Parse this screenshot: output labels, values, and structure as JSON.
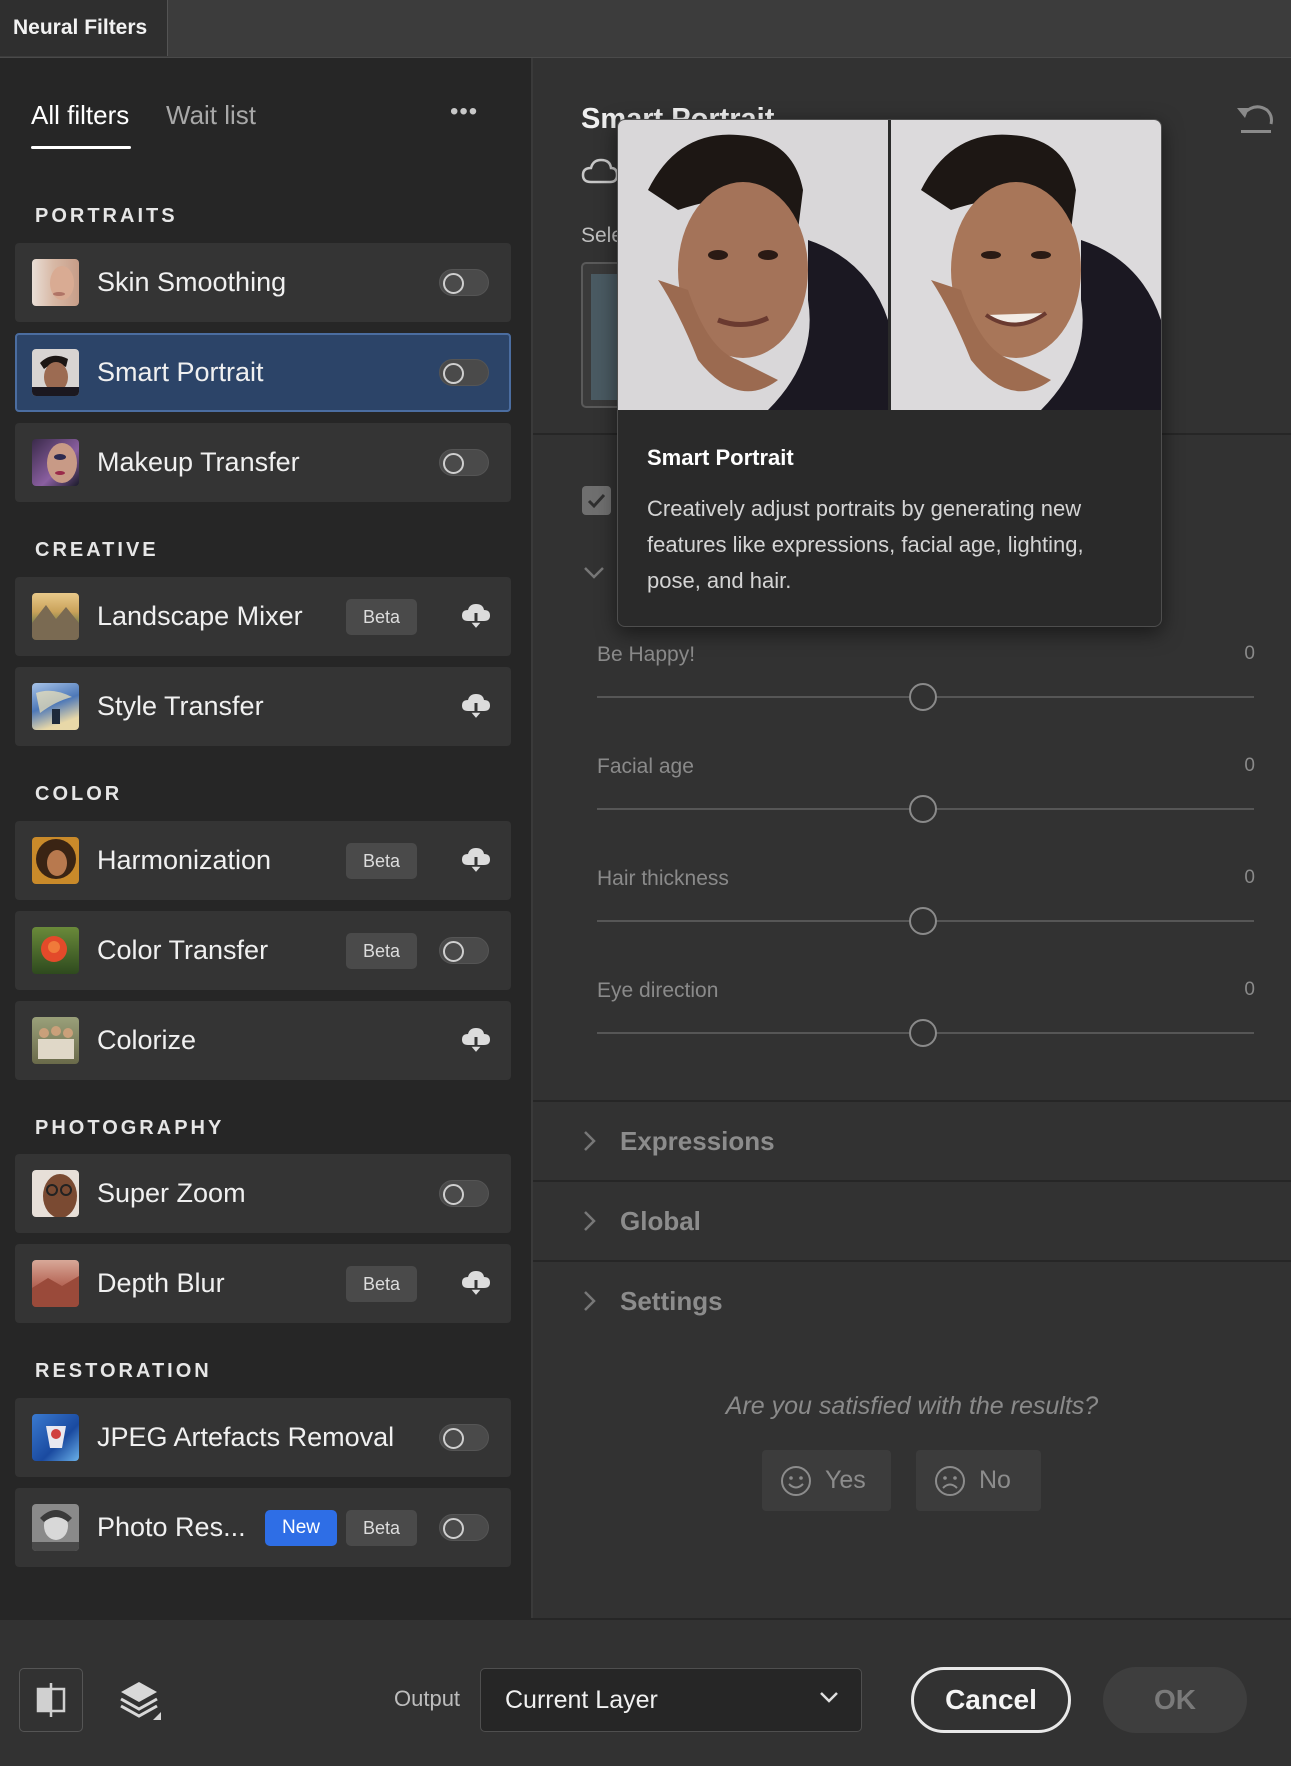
{
  "window": {
    "tab_title": "Neural Filters"
  },
  "left_panel": {
    "tabs": [
      {
        "label": "All filters",
        "active": true
      },
      {
        "label": "Wait list",
        "active": false
      }
    ],
    "more_label": "•••",
    "sections": [
      {
        "title": "PORTRAITS",
        "items": [
          {
            "label": "Skin Smoothing",
            "control": "toggle"
          },
          {
            "label": "Smart Portrait",
            "control": "toggle",
            "selected": true
          },
          {
            "label": "Makeup Transfer",
            "control": "toggle"
          }
        ]
      },
      {
        "title": "CREATIVE",
        "items": [
          {
            "label": "Landscape Mixer",
            "badge": "Beta",
            "control": "download"
          },
          {
            "label": "Style Transfer",
            "control": "download"
          }
        ]
      },
      {
        "title": "COLOR",
        "items": [
          {
            "label": "Harmonization",
            "badge": "Beta",
            "control": "download"
          },
          {
            "label": "Color Transfer",
            "badge": "Beta",
            "control": "toggle"
          },
          {
            "label": "Colorize",
            "control": "download"
          }
        ]
      },
      {
        "title": "PHOTOGRAPHY",
        "items": [
          {
            "label": "Super Zoom",
            "control": "toggle"
          },
          {
            "label": "Depth Blur",
            "badge": "Beta",
            "control": "download"
          }
        ]
      },
      {
        "title": "RESTORATION",
        "items": [
          {
            "label": "JPEG Artefacts Removal",
            "control": "toggle"
          },
          {
            "label": "Photo Res...",
            "badge_new": "New",
            "badge": "Beta",
            "control": "toggle"
          }
        ]
      }
    ]
  },
  "right_panel": {
    "title": "Smart Portrait",
    "select_label": "Sele",
    "sliders": [
      {
        "label": "Be Happy!",
        "value": "0"
      },
      {
        "label": "Facial age",
        "value": "0"
      },
      {
        "label": "Hair thickness",
        "value": "0"
      },
      {
        "label": "Eye direction",
        "value": "0"
      }
    ],
    "accordions": [
      "Expressions",
      "Global",
      "Settings"
    ],
    "survey_question": "Are you satisfied with the results?",
    "yes_label": "Yes",
    "no_label": "No"
  },
  "popup": {
    "title": "Smart Portrait",
    "description": "Creatively adjust portraits by generating new features like expressions, facial age, lighting, pose, and hair."
  },
  "bottom_bar": {
    "output_label": "Output",
    "output_value": "Current Layer",
    "cancel_label": "Cancel",
    "ok_label": "OK"
  }
}
